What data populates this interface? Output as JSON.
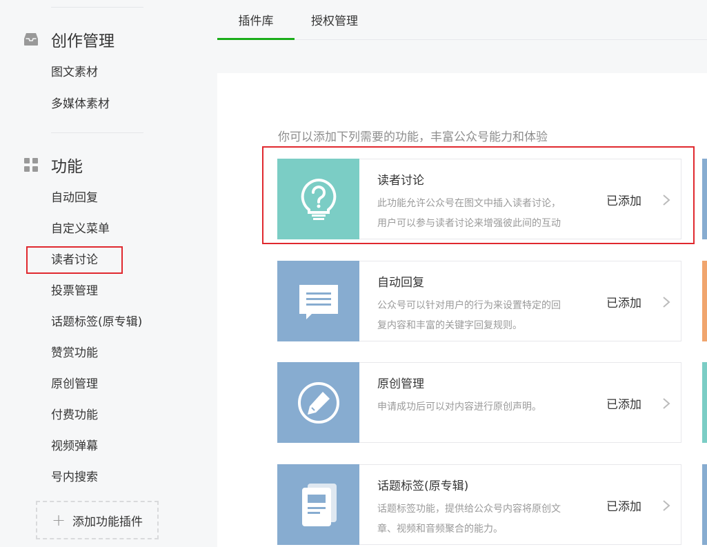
{
  "sidebar": {
    "sections": [
      {
        "title": "创作管理",
        "icon": "inbox-icon",
        "items": [
          "图文素材",
          "多媒体素材"
        ]
      },
      {
        "title": "功能",
        "icon": "grid-icon",
        "items": [
          "自动回复",
          "自定义菜单",
          "读者讨论",
          "投票管理",
          "话题标签(原专辑)",
          "赞赏功能",
          "原创管理",
          "付费功能",
          "视频弹幕",
          "号内搜索"
        ]
      }
    ],
    "add_plugin_label": "添加功能插件"
  },
  "tabs": [
    {
      "label": "插件库",
      "active": true
    },
    {
      "label": "授权管理",
      "active": false
    }
  ],
  "intro": "你可以添加下列需要的功能，丰富公众号能力和体验",
  "plugins": [
    {
      "name": "读者讨论",
      "desc_line1": "此功能允许公众号在图文中插入读者讨论，",
      "desc_line2": "用户可以参与读者讨论来增强彼此间的互动",
      "status": "已添加",
      "icon": "question-bulb-icon",
      "color": "#7bcdc5"
    },
    {
      "name": "自动回复",
      "desc_line1": "公众号可以针对用户的行为来设置特定的回",
      "desc_line2": "复内容和丰富的关键字回复规则。",
      "status": "已添加",
      "icon": "message-icon",
      "color": "#87acd0"
    },
    {
      "name": "原创管理",
      "desc_line1": "申请成功后可以对内容进行原创声明。",
      "desc_line2": "",
      "status": "已添加",
      "icon": "pencil-circle-icon",
      "color": "#87acd0"
    },
    {
      "name": "话题标签(原专辑)",
      "desc_line1": "话题标签功能，提供给公众号内容将原创文",
      "desc_line2": "章、视频和音频聚合的能力。",
      "status": "已添加",
      "icon": "album-icon",
      "color": "#87acd0"
    }
  ],
  "colors": {
    "accent_green": "#1aad19",
    "highlight_red": "#e0282e",
    "edge_strips": [
      "#87acd0",
      "#f0a56e",
      "#7bcdc5",
      "#87acd0"
    ]
  }
}
